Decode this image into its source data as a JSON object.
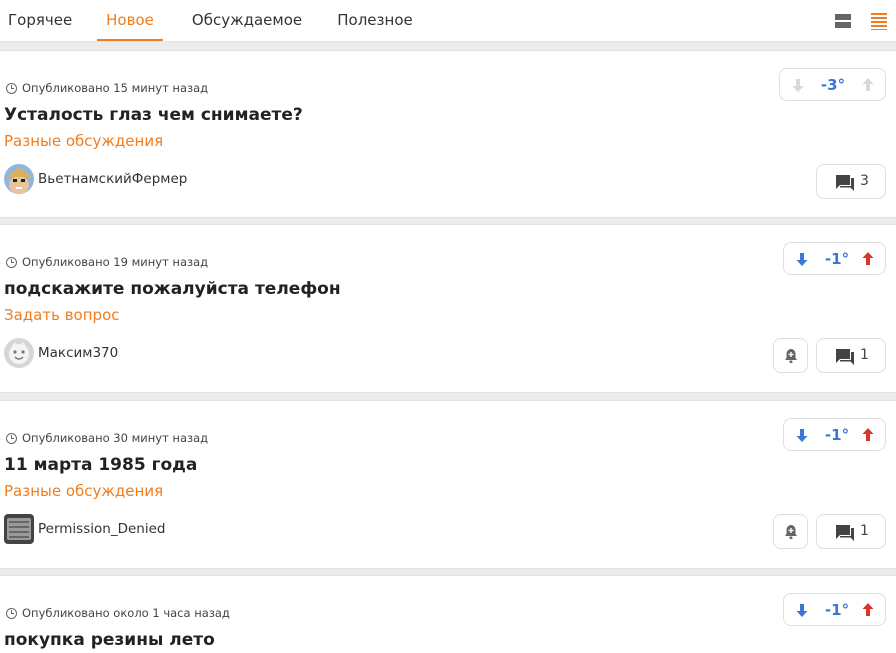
{
  "tabs": [
    {
      "label": "Горячее",
      "active": false
    },
    {
      "label": "Новое",
      "active": true
    },
    {
      "label": "Обсуждаемое",
      "active": false
    },
    {
      "label": "Полезное",
      "active": false
    }
  ],
  "colors": {
    "accent": "#f07d1e",
    "vote_down": "#3b77d4",
    "vote_up": "#d9362b",
    "disabled_arrow": "#d8d8d8"
  },
  "view_toggle": {
    "compact_icon": "view-compact-icon",
    "list_icon": "view-list-icon",
    "active": "list"
  },
  "posts": [
    {
      "published": "Опубликовано 15 минут назад",
      "title": "Усталость глаз чем снимаете?",
      "community": "Разные обсуждения",
      "author": "ВьетнамскийФермер",
      "rating": "-3°",
      "votes_enabled": false,
      "comments": "3",
      "has_subscribe": false
    },
    {
      "published": "Опубликовано 19 минут назад",
      "title": "подскажите пожалуйста телефон",
      "community": "Задать вопрос",
      "author": "Максим370",
      "rating": "-1°",
      "votes_enabled": true,
      "comments": "1",
      "has_subscribe": true
    },
    {
      "published": "Опубликовано 30 минут назад",
      "title": "11 марта 1985 года",
      "community": "Разные обсуждения",
      "author": "Permission_Denied",
      "rating": "-1°",
      "votes_enabled": true,
      "comments": "1",
      "has_subscribe": true
    },
    {
      "published": "Опубликовано около 1 часа назад",
      "title": "покупка резины лето",
      "rating": "-1°",
      "votes_enabled": true
    }
  ]
}
